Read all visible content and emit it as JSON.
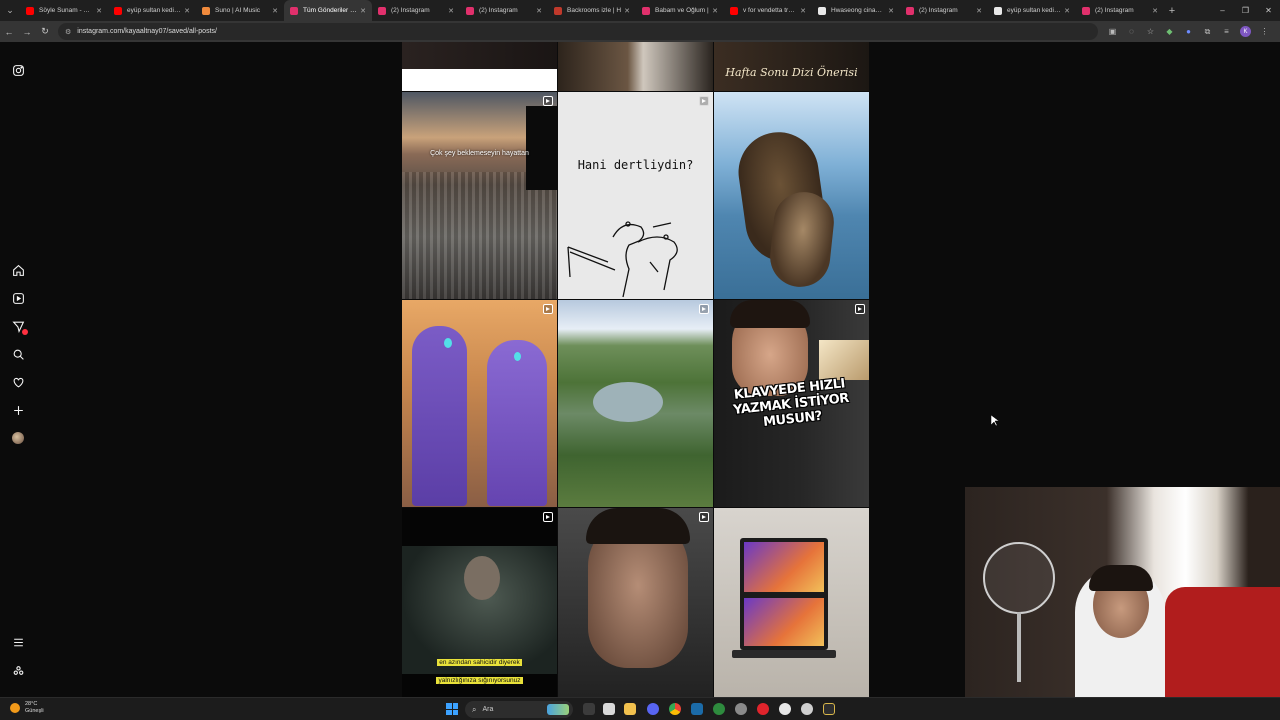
{
  "browser": {
    "tabs": [
      {
        "title": "Söyle Sunam - YouT",
        "color": "#ff0000"
      },
      {
        "title": "eyüp sultan kedi be",
        "color": "#ff0000"
      },
      {
        "title": "Suno | AI Music",
        "color": "#f08a3c"
      },
      {
        "title": "Tüm Gönderiler • In",
        "color": "#e1306c",
        "active": true
      },
      {
        "title": "(2) Instagram",
        "color": "#e1306c"
      },
      {
        "title": "(2) Instagram",
        "color": "#e1306c"
      },
      {
        "title": "Backrooms izle | H",
        "color": "#c0392b"
      },
      {
        "title": "Babam ve Oğlum |",
        "color": "#e1306c"
      },
      {
        "title": "v for vendetta traile",
        "color": "#ff0000"
      },
      {
        "title": "Hwaseong cinayetl",
        "color": "#e8e8e8"
      },
      {
        "title": "(2) Instagram",
        "color": "#e1306c"
      },
      {
        "title": "eyüp sultan kedi be",
        "color": "#e8e8e8"
      },
      {
        "title": "(2) Instagram",
        "color": "#e1306c"
      }
    ],
    "url": "instagram.com/kayaaltnay07/saved/all-posts/",
    "profile_initial": "K"
  },
  "posts": {
    "top_right_caption": "Hafta Sonu Dizi Önerisi",
    "city_caption": "Çok şey beklemeseyin hayattan",
    "sketch_caption": "Hani dertliydin?",
    "youtuber_caption": "KLAVYEDE HIZLI YAZMAK İSTİYOR MUSUN?",
    "movie_subtitle_1": "en azından sahicidir diyerek",
    "movie_subtitle_2": "yalnızlığınıza sığınıyorsunuz"
  },
  "taskbar": {
    "weather_temp": "28°C",
    "weather_desc": "Güneşli",
    "search_placeholder": "Ara"
  },
  "colors": {
    "accent": "#3ca2ff",
    "notification": "#ff3040",
    "page_bg": "#0b0b0b"
  }
}
